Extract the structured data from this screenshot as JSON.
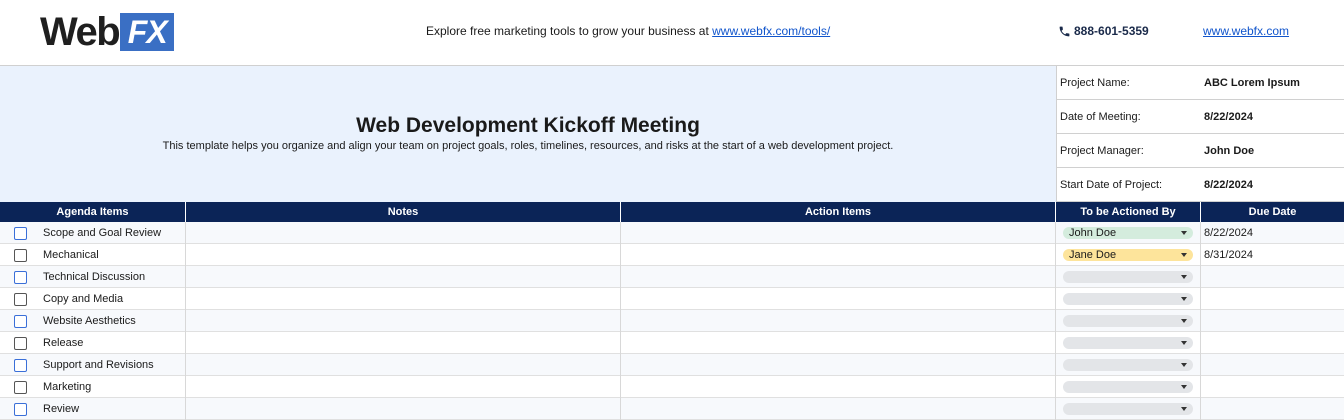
{
  "brand": {
    "logo_main": "Web",
    "logo_accent": "FX",
    "accent_color": "#3a6fc4"
  },
  "topbar": {
    "tagline": "Explore free marketing tools to grow your business at ",
    "tagline_link": "www.webfx.com/tools/",
    "phone": "888-601-5359",
    "site_link": "www.webfx.com"
  },
  "banner": {
    "title": "Web Development Kickoff Meeting",
    "description": "This template helps you organize and align your team on project goals, roles, timelines, resources, and risks at the start of a web development project."
  },
  "info": [
    {
      "label": "Project Name:",
      "value": "ABC Lorem Ipsum"
    },
    {
      "label": "Date of Meeting:",
      "value": "8/22/2024"
    },
    {
      "label": "Project Manager:",
      "value": "John Doe"
    },
    {
      "label": "Start Date of Project:",
      "value": "8/22/2024"
    }
  ],
  "table": {
    "headers": [
      "Agenda Items",
      "Notes",
      "Action Items",
      "To be Actioned By",
      "Due Date"
    ],
    "rows": [
      {
        "agenda": "Scope and Goal Review",
        "notes": "",
        "action": "",
        "owner": "John Doe",
        "owner_color": "green",
        "due": "8/22/2024"
      },
      {
        "agenda": "Mechanical",
        "notes": "",
        "action": "",
        "owner": "Jane Doe",
        "owner_color": "yellow",
        "due": "8/31/2024"
      },
      {
        "agenda": "Technical Discussion",
        "notes": "",
        "action": "",
        "owner": "",
        "owner_color": "gray",
        "due": ""
      },
      {
        "agenda": "Copy and Media",
        "notes": "",
        "action": "",
        "owner": "",
        "owner_color": "gray",
        "due": ""
      },
      {
        "agenda": "Website Aesthetics",
        "notes": "",
        "action": "",
        "owner": "",
        "owner_color": "gray",
        "due": ""
      },
      {
        "agenda": "Release",
        "notes": "",
        "action": "",
        "owner": "",
        "owner_color": "gray",
        "due": ""
      },
      {
        "agenda": "Support and Revisions",
        "notes": "",
        "action": "",
        "owner": "",
        "owner_color": "gray",
        "due": ""
      },
      {
        "agenda": "Marketing",
        "notes": "",
        "action": "",
        "owner": "",
        "owner_color": "gray",
        "due": ""
      },
      {
        "agenda": "Review",
        "notes": "",
        "action": "",
        "owner": "",
        "owner_color": "gray",
        "due": ""
      }
    ]
  }
}
